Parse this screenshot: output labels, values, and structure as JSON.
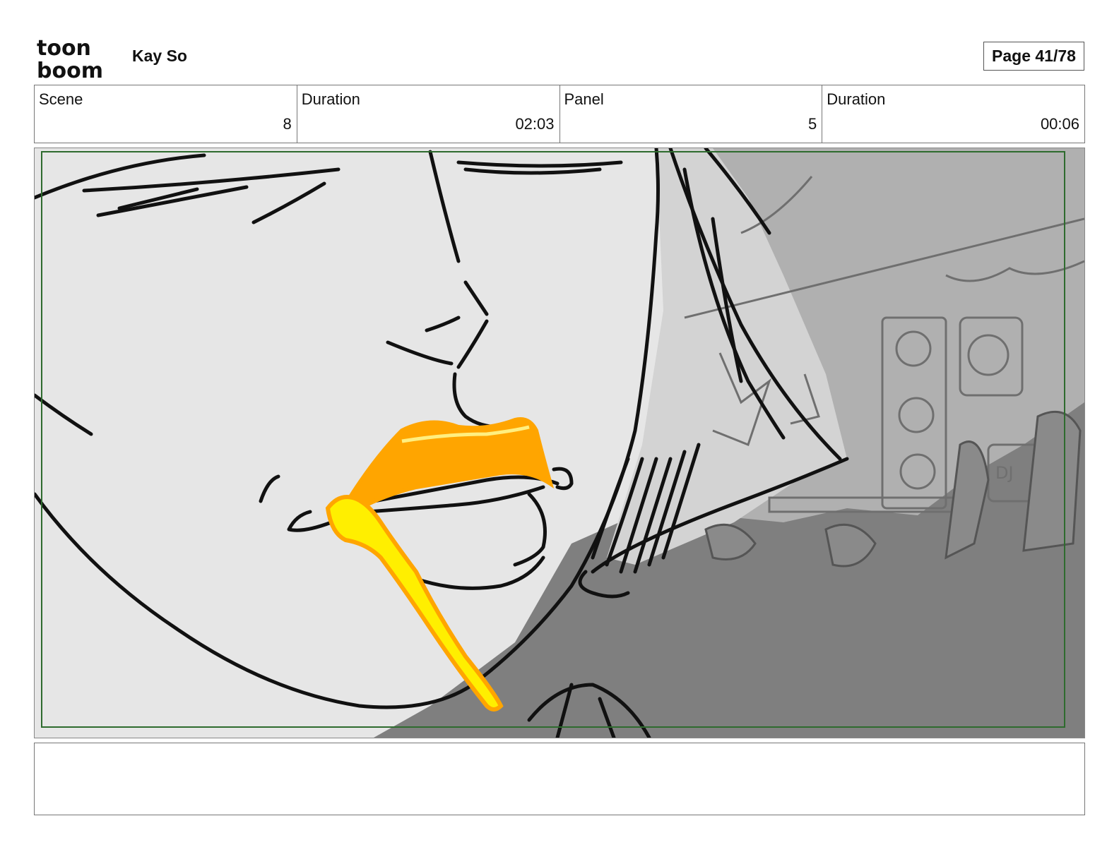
{
  "header": {
    "logo_line1": "toon",
    "logo_line2": "boom",
    "author": "Kay So",
    "page": "Page 41/78"
  },
  "info": [
    {
      "label": "Scene",
      "value": "8"
    },
    {
      "label": "Duration",
      "value": "02:03"
    },
    {
      "label": "Panel",
      "value": "5"
    },
    {
      "label": "Duration",
      "value": "00:06"
    }
  ],
  "panel": {
    "sign_text": "DJ",
    "colors": {
      "skin": "#e6e6e6",
      "background_light": "#b0b0b0",
      "background_dark": "#7f7f7f",
      "frame_border": "#2e6b2e",
      "lip_orange": "#ffa500",
      "lip_yellow": "#ffef00"
    }
  },
  "notes": ""
}
